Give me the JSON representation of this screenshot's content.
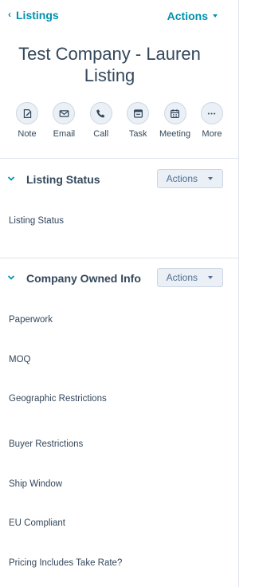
{
  "header": {
    "back_label": "Listings",
    "actions_label": "Actions"
  },
  "record": {
    "title": "Test Company - Lauren Listing"
  },
  "quick_actions": [
    {
      "label": "Note",
      "icon": "note-icon"
    },
    {
      "label": "Email",
      "icon": "email-icon"
    },
    {
      "label": "Call",
      "icon": "phone-icon"
    },
    {
      "label": "Task",
      "icon": "task-icon"
    },
    {
      "label": "Meeting",
      "icon": "calendar-icon"
    },
    {
      "label": "More",
      "icon": "more-icon"
    }
  ],
  "sections": {
    "listing_status": {
      "title": "Listing Status",
      "actions_label": "Actions",
      "properties": [
        "Listing Status"
      ]
    },
    "company_owned_info": {
      "title": "Company Owned Info",
      "actions_label": "Actions",
      "properties": [
        "Paperwork",
        "MOQ",
        "Geographic Restrictions",
        "Buyer Restrictions",
        "Ship Window",
        "EU Compliant",
        "Pricing Includes Take Rate?"
      ]
    }
  },
  "colors": {
    "link": "#0091ae",
    "text": "#33475b",
    "button_bg": "#eaf0f6",
    "border": "#cbd6e2",
    "divider": "#dfe3eb"
  }
}
